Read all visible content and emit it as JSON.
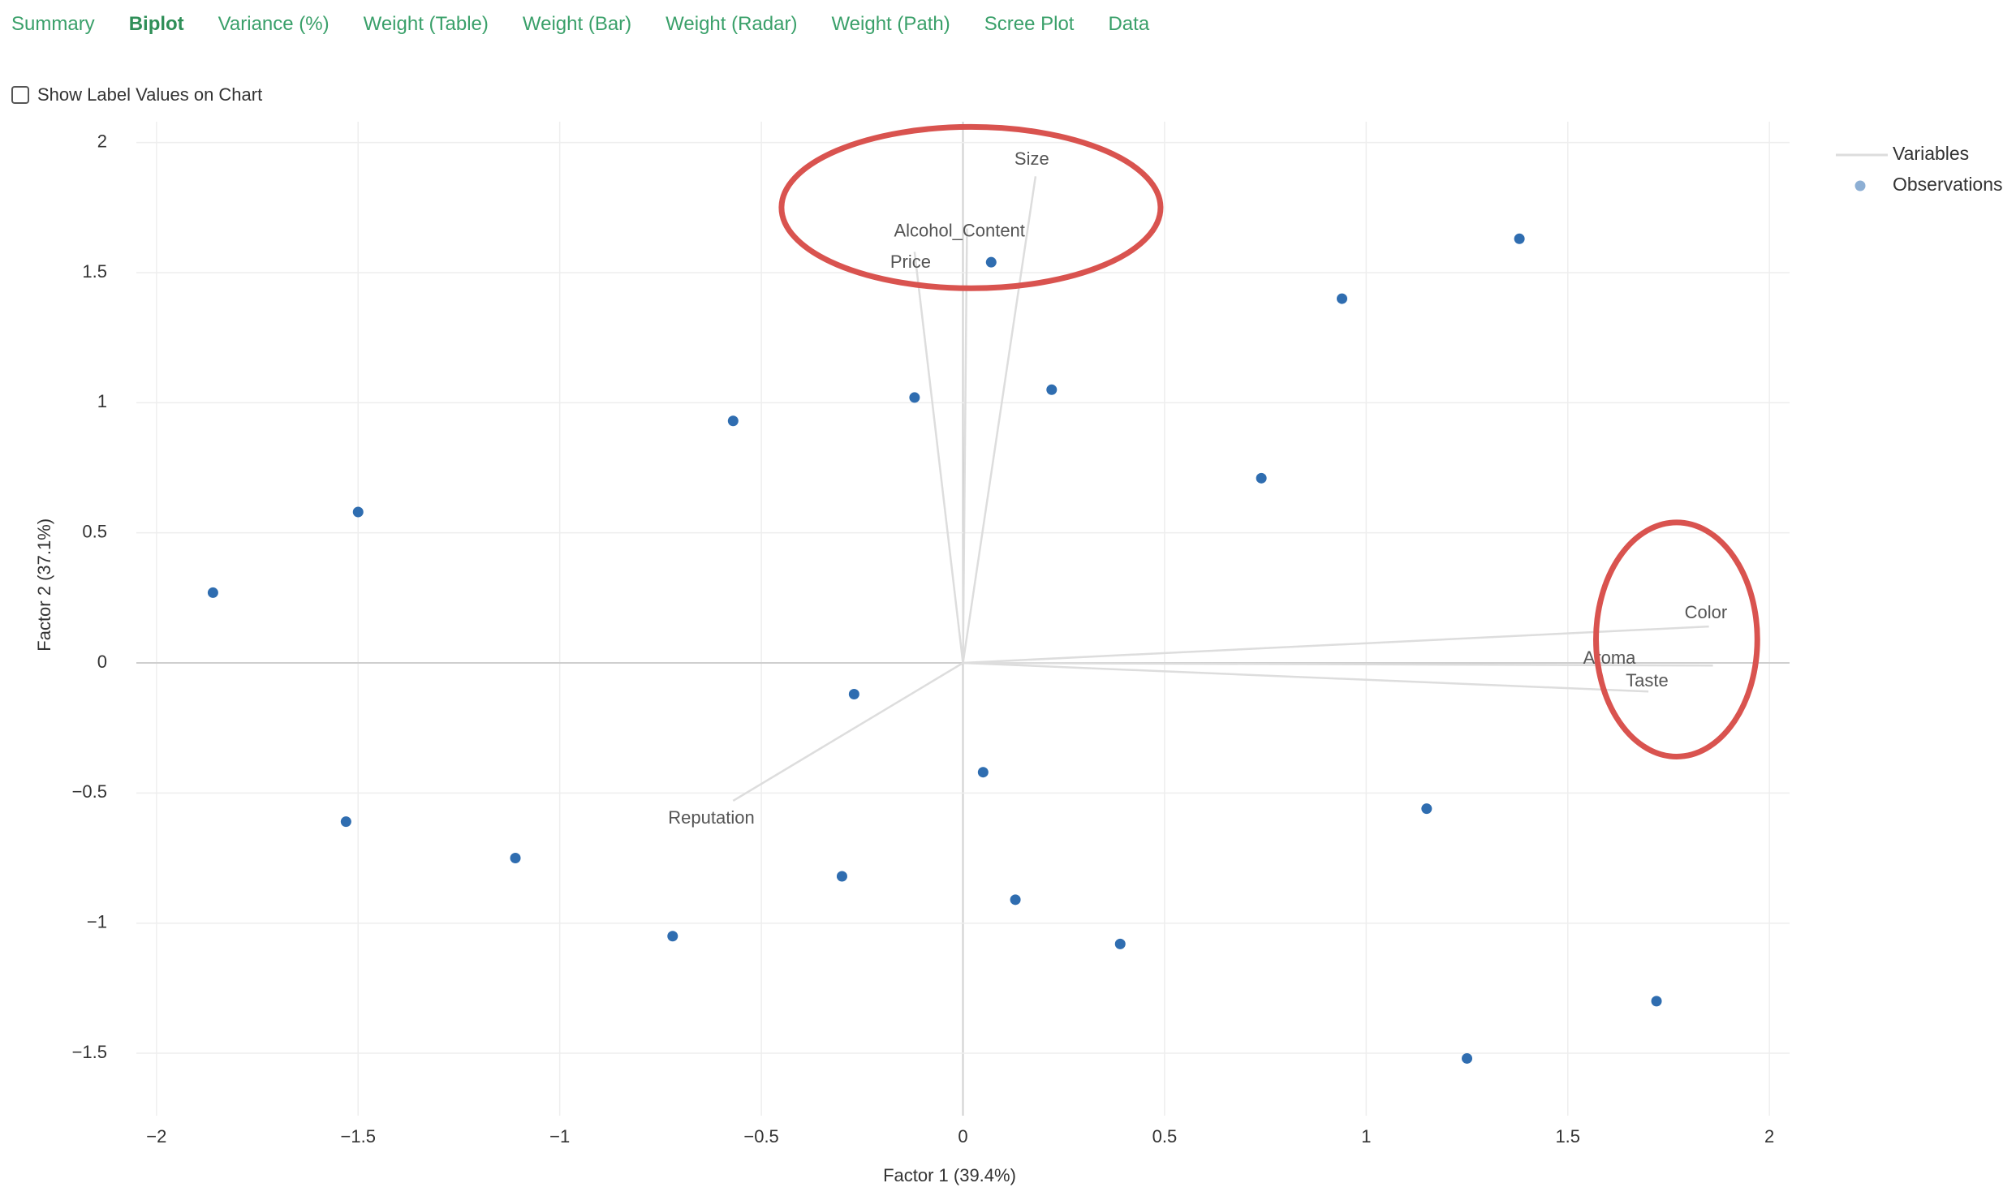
{
  "tabs": [
    {
      "label": "Summary",
      "active": false
    },
    {
      "label": "Biplot",
      "active": true
    },
    {
      "label": "Variance (%)",
      "active": false
    },
    {
      "label": "Weight (Table)",
      "active": false
    },
    {
      "label": "Weight (Bar)",
      "active": false
    },
    {
      "label": "Weight (Radar)",
      "active": false
    },
    {
      "label": "Weight (Path)",
      "active": false
    },
    {
      "label": "Scree Plot",
      "active": false
    },
    {
      "label": "Data",
      "active": false
    }
  ],
  "options": {
    "show_label_values": {
      "label": "Show Label Values on Chart",
      "checked": false
    }
  },
  "colors": {
    "accent": "#3aa06a",
    "observation": "#2f6db0",
    "variable_line": "#dddddd",
    "highlight": "#d9534f"
  },
  "chart_data": {
    "type": "scatter",
    "xlabel": "Factor 1 (39.4%)",
    "ylabel": "Factor 2 (37.1%)",
    "xlim": [
      -2.05,
      2.05
    ],
    "ylim": [
      -1.74,
      2.08
    ],
    "xticks": [
      -2,
      -1.5,
      -1,
      -0.5,
      0,
      0.5,
      1,
      1.5,
      2
    ],
    "yticks": [
      -1.5,
      -1,
      -0.5,
      0,
      0.5,
      1,
      1.5,
      2
    ],
    "xtick_labels": [
      "−2",
      "−1.5",
      "−1",
      "−0.5",
      "0",
      "0.5",
      "1",
      "1.5",
      "2"
    ],
    "ytick_labels": [
      "−1.5",
      "−1",
      "−0.5",
      "0",
      "0.5",
      "1",
      "1.5",
      "2"
    ],
    "grid": true,
    "legend_position": "top-right",
    "legend": [
      {
        "name": "Variables",
        "symbol": "line"
      },
      {
        "name": "Observations",
        "symbol": "dot"
      }
    ],
    "variables": [
      {
        "name": "Size",
        "x": 0.18,
        "y": 1.87
      },
      {
        "name": "Alcohol_Content",
        "x": 0.01,
        "y": 1.67
      },
      {
        "name": "Price",
        "x": -0.12,
        "y": 1.58
      },
      {
        "name": "Color",
        "x": 1.85,
        "y": 0.14
      },
      {
        "name": "Aroma",
        "x": 1.86,
        "y": -0.01
      },
      {
        "name": "Taste",
        "x": 1.7,
        "y": -0.11
      },
      {
        "name": "Reputation",
        "x": -0.57,
        "y": -0.53
      }
    ],
    "observations": [
      {
        "x": 0.07,
        "y": 1.54
      },
      {
        "x": 1.38,
        "y": 1.63
      },
      {
        "x": 0.94,
        "y": 1.4
      },
      {
        "x": -0.12,
        "y": 1.02
      },
      {
        "x": 0.22,
        "y": 1.05
      },
      {
        "x": -0.57,
        "y": 0.93
      },
      {
        "x": 0.74,
        "y": 0.71
      },
      {
        "x": -1.5,
        "y": 0.58
      },
      {
        "x": -1.86,
        "y": 0.27
      },
      {
        "x": -0.27,
        "y": -0.12
      },
      {
        "x": 0.05,
        "y": -0.42
      },
      {
        "x": -1.53,
        "y": -0.61
      },
      {
        "x": -1.11,
        "y": -0.75
      },
      {
        "x": 1.15,
        "y": -0.56
      },
      {
        "x": -0.3,
        "y": -0.82
      },
      {
        "x": 0.13,
        "y": -0.91
      },
      {
        "x": -0.72,
        "y": -1.05
      },
      {
        "x": 0.39,
        "y": -1.08
      },
      {
        "x": 1.72,
        "y": -1.3
      },
      {
        "x": 1.25,
        "y": -1.52
      }
    ],
    "annotations": [
      {
        "type": "ellipse",
        "cx": 0.02,
        "cy": 1.75,
        "rx": 0.47,
        "ry": 0.31
      },
      {
        "type": "ellipse",
        "cx": 1.77,
        "cy": 0.09,
        "rx": 0.2,
        "ry": 0.45
      }
    ]
  }
}
